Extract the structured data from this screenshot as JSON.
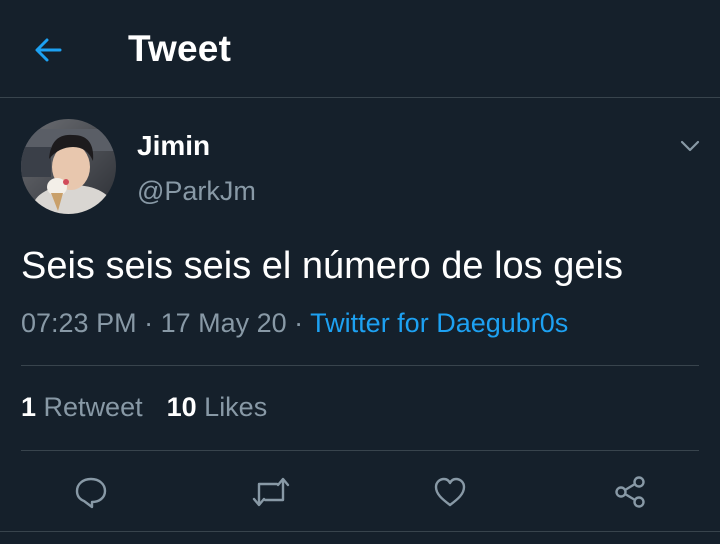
{
  "colors": {
    "background": "#15202b",
    "accent": "#1da1f2",
    "secondary_text": "#8899a6",
    "border": "#38444d"
  },
  "header": {
    "back_icon": "arrow-left-icon",
    "title": "Tweet"
  },
  "tweet": {
    "author": {
      "display_name": "Jimin",
      "handle": "@ParkJm",
      "avatar": "profile-photo"
    },
    "menu_icon": "chevron-down-icon",
    "text": "Seis seis seis el número de los geis",
    "time": "07:23 PM",
    "separator1": " · ",
    "date": "17 May 20",
    "separator2": " · ",
    "source": "Twitter for Daegubr0s"
  },
  "stats": {
    "retweets_count": "1",
    "retweets_label": "Retweet",
    "likes_count": "10",
    "likes_label": "Likes"
  },
  "actions": [
    {
      "icon": "reply-icon"
    },
    {
      "icon": "retweet-icon"
    },
    {
      "icon": "heart-icon"
    },
    {
      "icon": "share-icon"
    }
  ]
}
